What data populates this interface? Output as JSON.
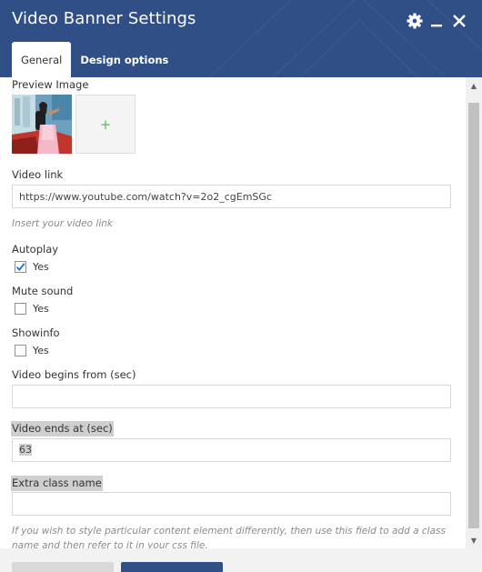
{
  "window": {
    "title": "Video Banner Settings",
    "icons": [
      "gear-icon",
      "minimize-icon",
      "close-icon"
    ]
  },
  "tabs": [
    {
      "label": "General",
      "active": true
    },
    {
      "label": "Design options",
      "active": false
    }
  ],
  "fields": {
    "preview_image": {
      "label": "Preview Image",
      "add_icon": "+"
    },
    "video_link": {
      "label": "Video link",
      "value": "https://www.youtube.com/watch?v=2o2_cgEmSGc",
      "help": "Insert your video link"
    },
    "autoplay": {
      "label": "Autoplay",
      "option": "Yes",
      "checked": true
    },
    "mute_sound": {
      "label": "Mute sound",
      "option": "Yes",
      "checked": false
    },
    "showinfo": {
      "label": "Showinfo",
      "option": "Yes",
      "checked": false
    },
    "video_begins": {
      "label": "Video begins from (sec)",
      "value": ""
    },
    "video_ends": {
      "label": "Video ends at (sec)",
      "value": "63"
    },
    "extra_class": {
      "label": "Extra class name",
      "value": "",
      "help": "If you wish to style particular content element differently, then use this field to add a class name and then refer to it in your css file."
    }
  },
  "colors": {
    "header_bg": "#2f4f86",
    "primary_button": "#2f4f86",
    "add_plus": "#5cb85c"
  }
}
